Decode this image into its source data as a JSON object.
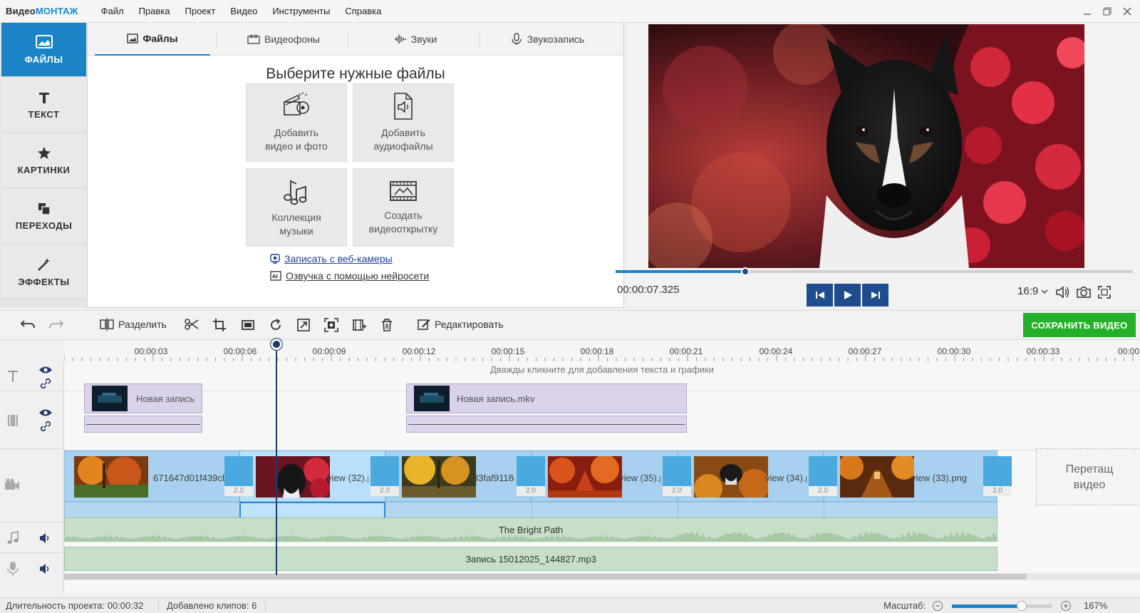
{
  "app": {
    "logo_part1": "Видео",
    "logo_part2": "МОНТАЖ"
  },
  "menu": [
    "Файл",
    "Правка",
    "Проект",
    "Видео",
    "Инструменты",
    "Справка"
  ],
  "leftnav": [
    "ФАЙЛЫ",
    "ТЕКСТ",
    "КАРТИНКИ",
    "ПЕРЕХОДЫ",
    "ЭФФЕКТЫ"
  ],
  "tabs": [
    "Файлы",
    "Видеофоны",
    "Звуки",
    "Звукозапись"
  ],
  "files": {
    "title": "Выберите нужные файлы",
    "cards": [
      {
        "line1": "Добавить",
        "line2": "видео и фото",
        "icon": "film-camera-icon"
      },
      {
        "line1": "Добавить",
        "line2": "аудиофайлы",
        "icon": "audio-file-icon"
      },
      {
        "line1": "Коллекция",
        "line2": "музыки",
        "icon": "music-notes-icon"
      },
      {
        "line1": "Создать",
        "line2": "видеооткрытку",
        "icon": "postcard-icon"
      }
    ],
    "webcam_link": "Записать с веб-камеры",
    "ai_link": "Озвучка с помощью нейросети"
  },
  "preview": {
    "time": "00:00:07.325",
    "aspect": "16:9",
    "progress": 0.25
  },
  "toolbar": {
    "split": "Разделить",
    "edit": "Редактировать",
    "save": "СОХРАНИТЬ ВИДЕО"
  },
  "ruler": [
    "00:00:03",
    "00:00:06",
    "00:00:09",
    "00:00:12",
    "00:00:15",
    "00:00:18",
    "00:00:21",
    "00:00:24",
    "00:00:27",
    "00:00:30",
    "00:00:33",
    "00:00"
  ],
  "timeline": {
    "text_hint": "Дважды кликните для добавления текста и графики",
    "overlay_clips": [
      "Новая запись",
      "Новая запись.mkv"
    ],
    "video_clips": [
      "671647d01f439cb",
      "view (32).p",
      "33faf9118e",
      "view (35).p",
      "view (34).p",
      "view (33).png"
    ],
    "transition_value": "2.0",
    "drop_hint_1": "Перетащ",
    "drop_hint_2": "видео",
    "music_track": "The Bright Path",
    "voice_track": "Запись 15012025_144827.mp3"
  },
  "status": {
    "duration": "Длительность проекта: 00:00:32",
    "clips": "Добавлено клипов: 6",
    "scale_label": "Масштаб:",
    "scale_value": "167%",
    "scale_level": 0.7
  }
}
